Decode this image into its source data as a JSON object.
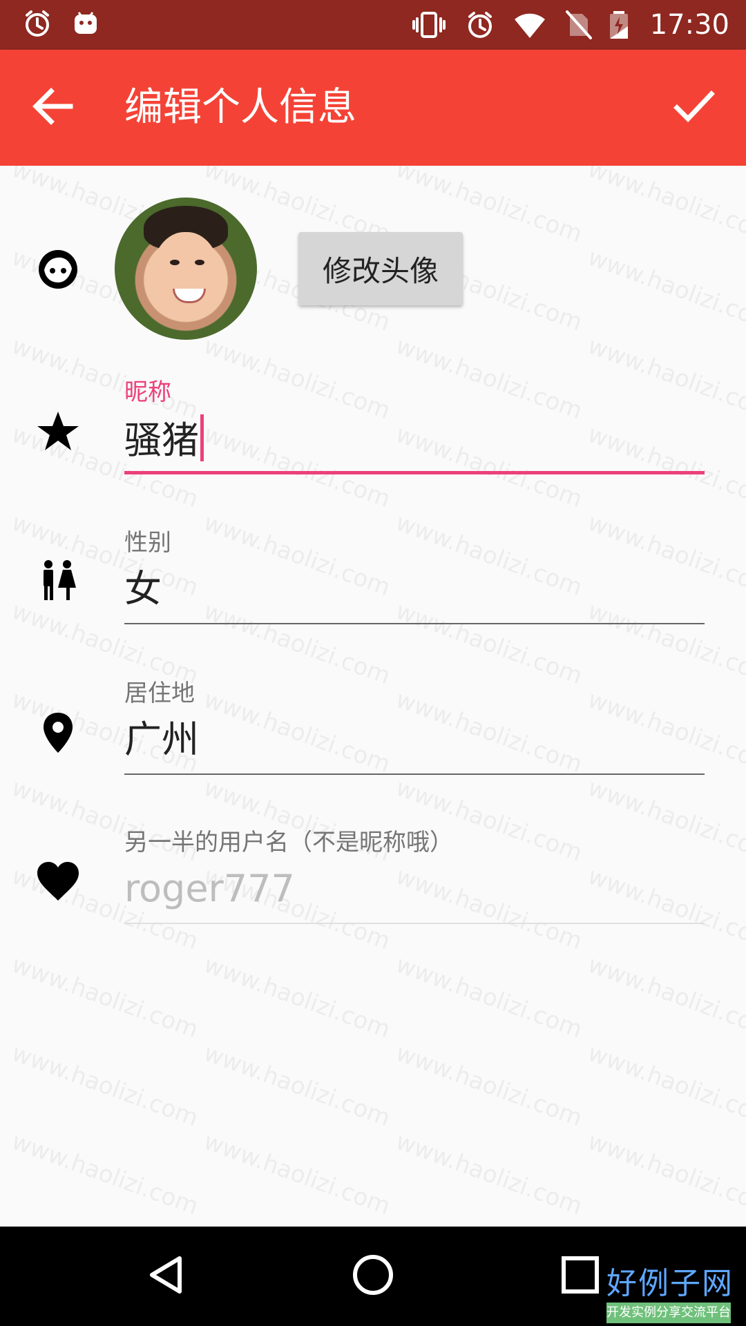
{
  "status_bar": {
    "time": "17:30",
    "left_icons": [
      "alarm-icon",
      "android-icon"
    ],
    "right_icons": [
      "vibrate-icon",
      "alarm-icon",
      "wifi-icon",
      "no-sim-icon",
      "battery-charging-icon"
    ]
  },
  "toolbar": {
    "title": "编辑个人信息",
    "back_icon": "arrow-back-icon",
    "confirm_icon": "check-icon"
  },
  "avatar_section": {
    "change_avatar_label": "修改头像"
  },
  "fields": {
    "nickname": {
      "label": "昵称",
      "value": "骚猪",
      "icon": "star-icon"
    },
    "gender": {
      "label": "性别",
      "value": "女",
      "icon": "wc-icon"
    },
    "location": {
      "label": "居住地",
      "value": "广州",
      "icon": "location-pin-icon"
    },
    "partner": {
      "label": "另一半的用户名（不是昵称哦）",
      "placeholder": "roger777",
      "icon": "heart-icon"
    }
  },
  "watermark": {
    "text": "www.haolizi.com"
  },
  "nav_bar": {
    "back_icon": "nav-back-icon",
    "home_icon": "nav-home-icon",
    "recents_icon": "nav-recents-icon"
  },
  "brand": {
    "title": "好例子网",
    "subtitle": "开发实例分享交流平台"
  },
  "colors": {
    "status_bar": "#8e2820",
    "toolbar": "#f44336",
    "accent": "#ec407a",
    "background": "#fafafa",
    "nav_bar": "#000000"
  }
}
